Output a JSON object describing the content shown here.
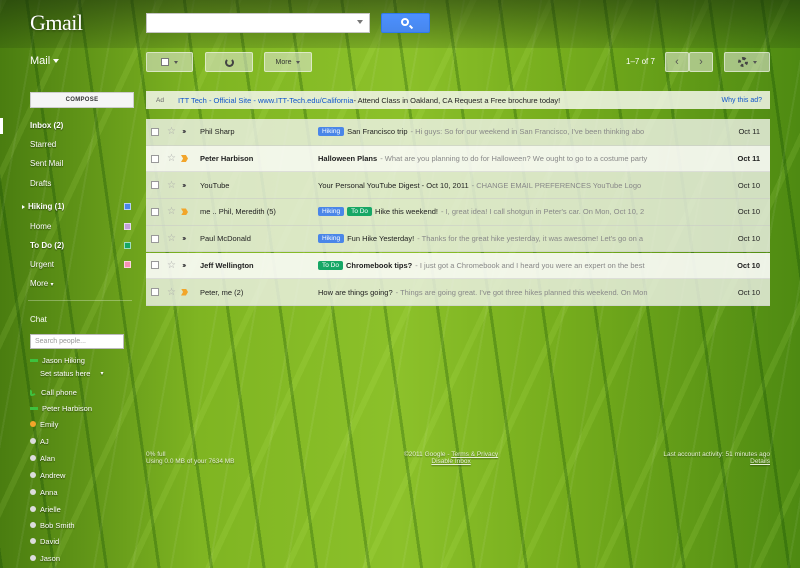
{
  "header": {
    "logo": "Gmail",
    "search": {
      "value": "",
      "placeholder": ""
    },
    "search_button_icon": "search-icon"
  },
  "toolbar": {
    "mail_label": "Mail",
    "more_label": "More",
    "page_count": "1–7 of 7"
  },
  "sidebar": {
    "compose_label": "COMPOSE",
    "items": [
      {
        "label": "Inbox (2)",
        "bold": true
      },
      {
        "label": "Starred"
      },
      {
        "label": "Sent Mail"
      },
      {
        "label": "Drafts"
      },
      {
        "label": "Hiking (1)",
        "bold": true,
        "color": "#4a86e8"
      },
      {
        "label": "Home",
        "color": "#c2a0d8"
      },
      {
        "label": "To Do (2)",
        "bold": true,
        "color": "#16a765"
      },
      {
        "label": "Urgent",
        "color": "#f691b2"
      },
      {
        "label": "More"
      }
    ]
  },
  "chat": {
    "title": "Chat",
    "search_placeholder": "Search people...",
    "me_name": "Jason Hiking",
    "status": "Set status here",
    "call_phone": "Call phone",
    "contacts": [
      {
        "name": "Peter Harbison",
        "status": "green-bar"
      },
      {
        "name": "Emily",
        "status": "orange"
      },
      {
        "name": "AJ",
        "status": "grey"
      },
      {
        "name": "Alan",
        "status": "grey"
      },
      {
        "name": "Andrew",
        "status": "grey"
      },
      {
        "name": "Anna",
        "status": "grey"
      },
      {
        "name": "Arielle",
        "status": "grey"
      },
      {
        "name": "Bob Smith",
        "status": "grey"
      },
      {
        "name": "David",
        "status": "grey"
      },
      {
        "name": "Jason",
        "status": "grey"
      }
    ]
  },
  "ad": {
    "tag": "Ad",
    "link": "ITT Tech - Official Site - www.ITT-Tech.edu/California",
    "text": " - Attend Class in Oakland, CA Request a Free brochure today!",
    "why": "Why this ad?"
  },
  "emails": [
    {
      "sender": "Phil Sharp",
      "labels": [
        {
          "text": "Hiking",
          "color": "blue"
        }
      ],
      "subject": "San Francisco trip",
      "snippet": " - Hi guys: So for our weekend in San Francisco, I've been thinking abo",
      "date": "Oct 11",
      "unread": false,
      "important": false
    },
    {
      "sender": "Peter Harbison",
      "labels": [],
      "subject": "Halloween Plans",
      "snippet": " - What are you planning to do for Halloween? We ought to go to a costume party",
      "date": "Oct 11",
      "unread": true,
      "important": true
    },
    {
      "sender": "YouTube",
      "labels": [],
      "subject": "Your Personal YouTube Digest - Oct 10, 2011",
      "snippet": " - CHANGE EMAIL PREFERENCES YouTube Logo",
      "date": "Oct 10",
      "unread": false,
      "important": false
    },
    {
      "sender": "me .. Phil, Meredith (5)",
      "labels": [
        {
          "text": "Hiking",
          "color": "blue"
        },
        {
          "text": "To Do",
          "color": "green"
        }
      ],
      "subject": "Hike this weekend!",
      "snippet": " - I, great idea! I call shotgun in Peter's car. On Mon, Oct 10, 2",
      "date": "Oct 10",
      "unread": false,
      "important": true
    },
    {
      "sender": "Paul McDonald",
      "labels": [
        {
          "text": "Hiking",
          "color": "blue"
        }
      ],
      "subject": "Fun Hike Yesterday!",
      "snippet": " - Thanks for the great hike yesterday, it was awesome! Let's go on a",
      "date": "Oct 10",
      "unread": false,
      "important": false
    },
    {
      "sender": "Jeff Wellington",
      "labels": [
        {
          "text": "To Do",
          "color": "green"
        }
      ],
      "subject": "Chromebook tips?",
      "snippet": " - I just got a Chromebook and I heard you were an expert on the best",
      "date": "Oct 10",
      "unread": true,
      "important": false
    },
    {
      "sender": "Peter, me (2)",
      "labels": [],
      "subject": "How are things going?",
      "snippet": " - Things are going great. I've got three hikes planned this weekend. On Mon",
      "date": "Oct 10",
      "unread": false,
      "important": true
    }
  ],
  "footer": {
    "usage_line1": "0% full",
    "usage_line2": "Using 0.0 MB of your 7634 MB",
    "copyright": "©2011 Google - ",
    "terms": "Terms & Privacy",
    "disable_inbox": "Disable Inbox",
    "activity": "Last account activity: 51 minutes ago",
    "details": "Details"
  }
}
